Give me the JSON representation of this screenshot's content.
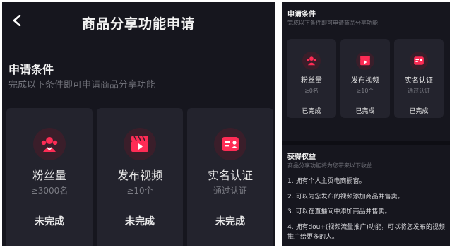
{
  "left": {
    "title": "商品分享功能申请",
    "section_title": "申请条件",
    "section_subtitle": "完成以下条件即可申请商品分享功能",
    "cards": [
      {
        "name": "粉丝量",
        "req": "≥3000名",
        "status": "未完成",
        "icon": "fans-icon"
      },
      {
        "name": "发布视频",
        "req": "≥10个",
        "status": "未完成",
        "icon": "video-clapper-icon"
      },
      {
        "name": "实名认证",
        "req": "通过认证",
        "status": "未完成",
        "icon": "id-card-icon"
      }
    ]
  },
  "right": {
    "section_title": "申请条件",
    "section_subtitle": "完成以下条件即可申请商品分享功能",
    "cards": [
      {
        "name": "粉丝量",
        "req": "≥0名",
        "status": "已完成",
        "icon": "fans-icon"
      },
      {
        "name": "发布视频",
        "req": "≥10个",
        "status": "已完成",
        "icon": "video-clapper-icon"
      },
      {
        "name": "实名认证",
        "req": "通过认证",
        "status": "已完成",
        "icon": "id-card-icon"
      }
    ],
    "benefits_title": "获得权益",
    "benefits_subtitle": "商品分享功能将为您带来以下收益",
    "benefits": [
      "1. 拥有个人主页电商橱窗。",
      "2. 可以为您发布的视频添加商品并售卖。",
      "3. 可以在直播间中添加商品并售卖。",
      "4. 拥有dou+(视频流量推广)功能，可以将您发布的视频推广给更多的人。"
    ]
  },
  "colors": {
    "background": "#16161e",
    "card": "#23232d",
    "accent": "#fe2c55"
  }
}
